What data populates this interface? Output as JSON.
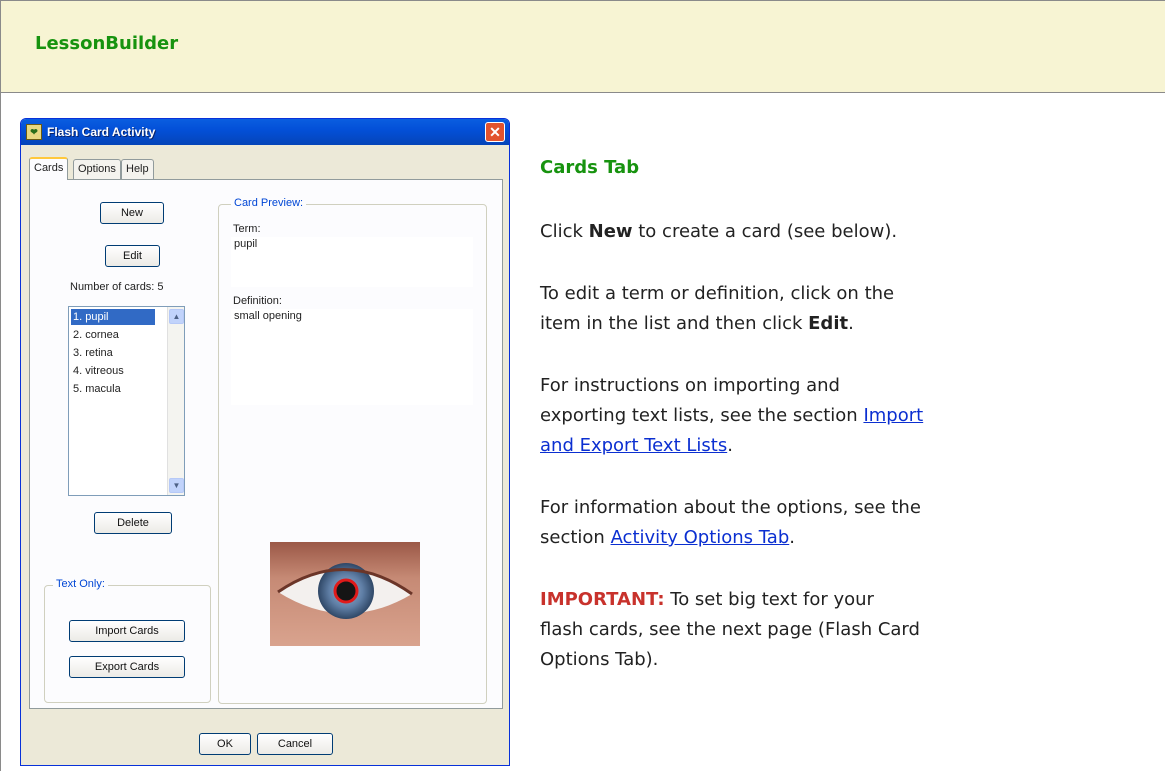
{
  "header": {
    "title": "LessonBuilder"
  },
  "dialog": {
    "title": "Flash Card Activity",
    "app_icon_glyph": "❤",
    "close_glyph": "✕",
    "tabs": [
      "Cards",
      "Options",
      "Help"
    ],
    "active_tab": "Cards",
    "buttons": {
      "new": "New",
      "edit": "Edit",
      "delete": "Delete",
      "import": "Import Cards",
      "export": "Export Cards",
      "ok": "OK",
      "cancel": "Cancel"
    },
    "number_of_cards_label": "Number of cards: 5",
    "cards": [
      "1. pupil",
      "2. cornea",
      "3. retina",
      "4. vitreous",
      "5. macula"
    ],
    "selected_card": "1. pupil",
    "text_only_legend": "Text Only:",
    "card_preview": {
      "legend": "Card Preview:",
      "term_label": "Term:",
      "term_value": "pupil",
      "definition_label": "Definition:",
      "definition_value": "small opening"
    },
    "scroll_up_glyph": "▲",
    "scroll_down_glyph": "▼",
    "preview_image_icon": "eye-image"
  },
  "content": {
    "section_title": "Cards Tab",
    "p1": {
      "pre": "Click ",
      "bold": "New",
      "post": " to create a card (see below)."
    },
    "p2": {
      "line1": "To edit a term or definition, click on the",
      "pre": "item in the list and then click ",
      "bold": "Edit",
      "post": "."
    },
    "p3": {
      "line1": "For instructions on importing and",
      "pre": "exporting text lists, see the section ",
      "link1": "Import",
      "link2": "and Export Text Lists",
      "post": "."
    },
    "p4": {
      "line1": "For information about the options, see the",
      "pre": "section ",
      "link": "Activity Options Tab",
      "post": "."
    },
    "p5": {
      "important": "IMPORTANT:",
      "rest1": " To set big text for your",
      "line2": "flash cards, see the next page (Flash Card",
      "line3": "Options Tab)."
    }
  },
  "colors": {
    "header_bg": "#f7f4d3",
    "title_green": "#17930f",
    "link_blue": "#0b2fd1",
    "important_red": "#c8322c",
    "xp_blue": "#0350d8"
  }
}
